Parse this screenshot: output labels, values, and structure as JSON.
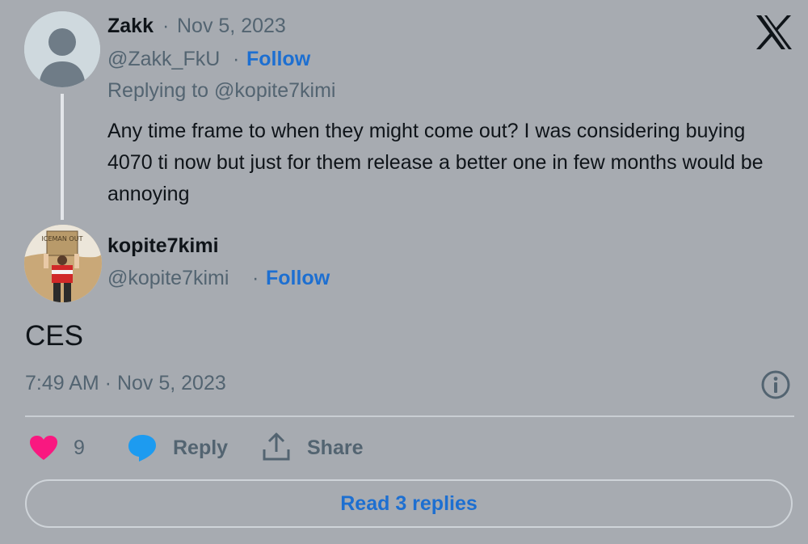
{
  "parent_tweet": {
    "author_name": "Zakk",
    "separator": "·",
    "date": "Nov 5, 2023",
    "handle": "@Zakk_FkU",
    "follow_label": "Follow",
    "replying_prefix": "Replying to",
    "replying_to": "@kopite7kimi",
    "text": "Any time frame to when they might come out? I was considering buying 4070 ti now but just for them release a better one in few months would be annoying"
  },
  "main_tweet": {
    "author_name": "kopite7kimi",
    "handle": "@kopite7kimi",
    "separator": "·",
    "follow_label": "Follow",
    "avatar_sign_text": "ICEMAN OUT",
    "text": "CES",
    "timestamp": "7:49 AM · Nov 5, 2023"
  },
  "actions": {
    "like_count": "9",
    "reply_label": "Reply",
    "share_label": "Share",
    "read_replies_label": "Read 3 replies"
  },
  "colors": {
    "background": "#a7abb1",
    "like": "#f91880",
    "reply": "#1d9bf0",
    "link": "#1d6fd1"
  }
}
